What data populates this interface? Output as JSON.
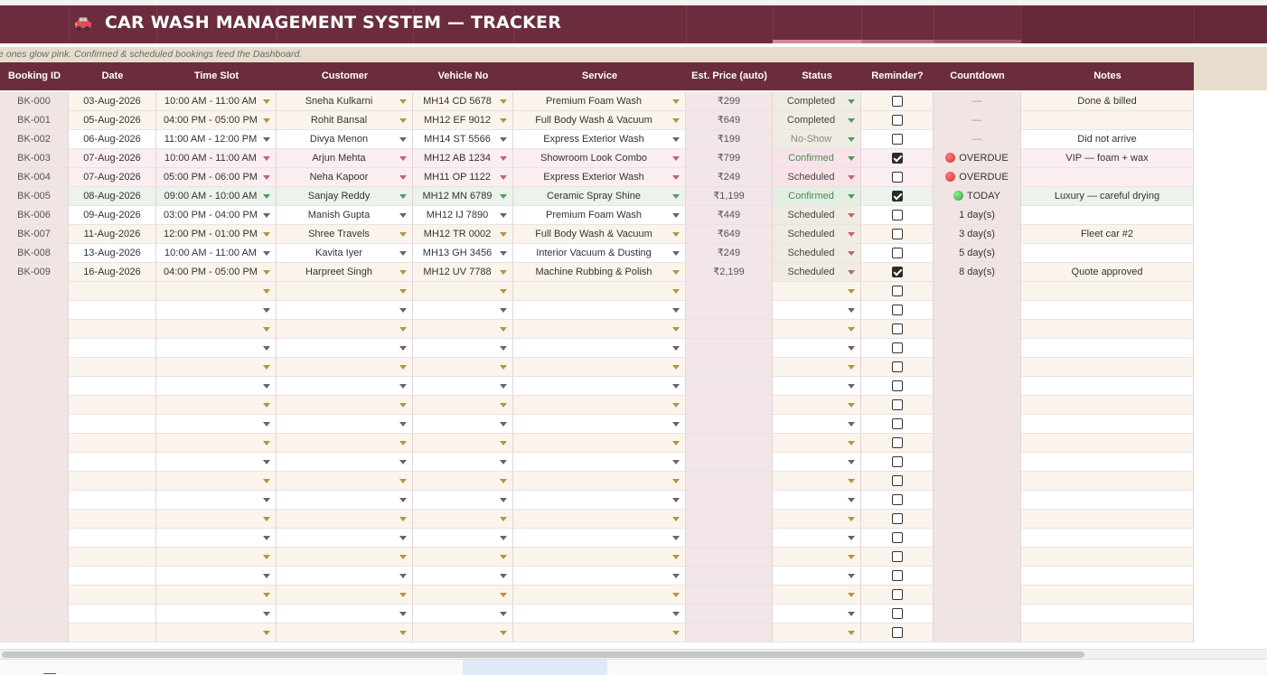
{
  "app": {
    "title": "CAR WASH MANAGEMENT SYSTEM — TRACKER",
    "hint": "e ones glow pink. Confirmed & scheduled bookings feed the Dashboard."
  },
  "columns": [
    "Booking ID",
    "Date",
    "Time Slot",
    "Customer",
    "Vehicle No",
    "Service",
    "Est. Price (auto)",
    "Status",
    "Reminder?",
    "Countdown",
    "Notes"
  ],
  "bookings": [
    {
      "id": "BK-000",
      "date": "03-Aug-2026",
      "slot": "10:00 AM - 11:00 AM",
      "customer": "Sneha Kulkarni",
      "vehicle": "MH14 CD 5678",
      "service": "Premium Foam Wash",
      "price": "₹299",
      "status": "Completed",
      "reminder": false,
      "countdown": "—",
      "notes": "Done & billed",
      "tone": "cream"
    },
    {
      "id": "BK-001",
      "date": "05-Aug-2026",
      "slot": "04:00 PM - 05:00 PM",
      "customer": "Rohit Bansal",
      "vehicle": "MH12 EF 9012",
      "service": "Full Body Wash & Vacuum",
      "price": "₹649",
      "status": "Completed",
      "reminder": false,
      "countdown": "—",
      "notes": "",
      "tone": "cream"
    },
    {
      "id": "BK-002",
      "date": "06-Aug-2026",
      "slot": "11:00 AM - 12:00 PM",
      "customer": "Divya Menon",
      "vehicle": "MH14 ST 5566",
      "service": "Express Exterior Wash",
      "price": "₹199",
      "status": "No-Show",
      "reminder": false,
      "countdown": "—",
      "notes": "Did not arrive",
      "tone": "white"
    },
    {
      "id": "BK-003",
      "date": "07-Aug-2026",
      "slot": "10:00 AM - 11:00 AM",
      "customer": "Arjun Mehta",
      "vehicle": "MH12 AB 1234",
      "service": "Showroom Look Combo",
      "price": "₹799",
      "status": "Confirmed",
      "reminder": true,
      "countdown": "OVERDUE",
      "countdown_dot": "red",
      "notes": "VIP — foam + wax",
      "tone": "pink"
    },
    {
      "id": "BK-004",
      "date": "07-Aug-2026",
      "slot": "05:00 PM - 06:00 PM",
      "customer": "Neha Kapoor",
      "vehicle": "MH11 OP 1122",
      "service": "Express Exterior Wash",
      "price": "₹249",
      "status": "Scheduled",
      "reminder": false,
      "countdown": "OVERDUE",
      "countdown_dot": "red",
      "notes": "",
      "tone": "pink"
    },
    {
      "id": "BK-005",
      "date": "08-Aug-2026",
      "slot": "09:00 AM - 10:00 AM",
      "customer": "Sanjay Reddy",
      "vehicle": "MH12 MN 6789",
      "service": "Ceramic Spray Shine",
      "price": "₹1,199",
      "status": "Confirmed",
      "reminder": true,
      "countdown": "TODAY",
      "countdown_dot": "green",
      "notes": "Luxury — careful drying",
      "tone": "green"
    },
    {
      "id": "BK-006",
      "date": "09-Aug-2026",
      "slot": "03:00 PM - 04:00 PM",
      "customer": "Manish Gupta",
      "vehicle": "MH12 IJ 7890",
      "service": "Premium Foam Wash",
      "price": "₹449",
      "status": "Scheduled",
      "reminder": false,
      "countdown": "1 day(s)",
      "notes": "",
      "tone": "white"
    },
    {
      "id": "BK-007",
      "date": "11-Aug-2026",
      "slot": "12:00 PM - 01:00 PM",
      "customer": "Shree Travels",
      "vehicle": "MH12 TR 0002",
      "service": "Full Body Wash & Vacuum",
      "price": "₹649",
      "status": "Scheduled",
      "reminder": false,
      "countdown": "3 day(s)",
      "notes": "Fleet car #2",
      "tone": "cream"
    },
    {
      "id": "BK-008",
      "date": "13-Aug-2026",
      "slot": "10:00 AM - 11:00 AM",
      "customer": "Kavita Iyer",
      "vehicle": "MH13 GH 3456",
      "service": "Interior Vacuum & Dusting",
      "price": "₹249",
      "status": "Scheduled",
      "reminder": false,
      "countdown": "5 day(s)",
      "notes": "",
      "tone": "white"
    },
    {
      "id": "BK-009",
      "date": "16-Aug-2026",
      "slot": "04:00 PM - 05:00 PM",
      "customer": "Harpreet Singh",
      "vehicle": "MH12 UV 7788",
      "service": "Machine Rubbing & Polish",
      "price": "₹2,199",
      "status": "Scheduled",
      "reminder": true,
      "countdown": "8 day(s)",
      "notes": "Quote approved",
      "tone": "cream"
    }
  ],
  "empty_rows": 20,
  "colors": {
    "brand": "#6b2d3d",
    "hint_bg": "#e8dccd",
    "pink_row": "#fbeef1",
    "cream_row": "#faf4ec",
    "green_row": "#ecf3ea",
    "id_col": "#f1e4e4",
    "price_col": "#f2e6e8"
  }
}
